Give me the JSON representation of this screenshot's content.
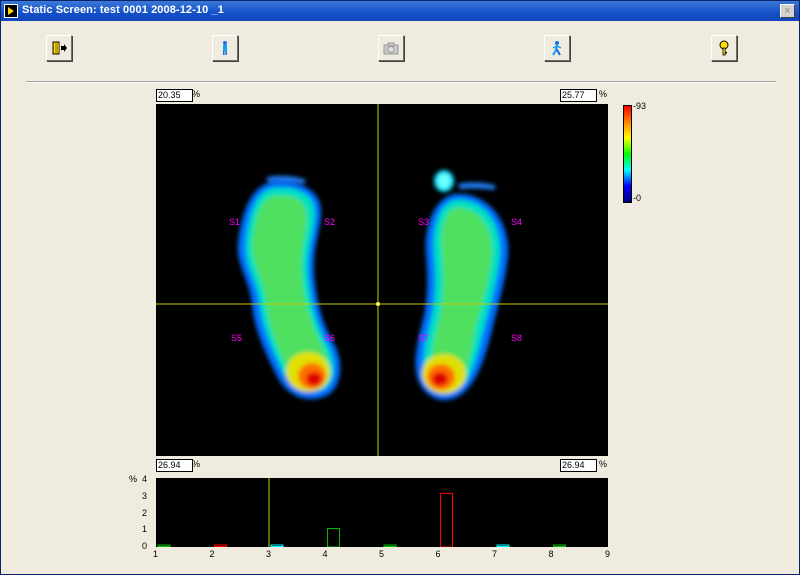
{
  "window": {
    "title": "Static Screen: test 0001 2008-12-10 _1",
    "close_label": "×"
  },
  "toolbar": [
    {
      "name": "exit-button",
      "icon": "exit-door-icon",
      "enabled": true
    },
    {
      "name": "standing-person-button",
      "icon": "standing-person-icon",
      "enabled": true
    },
    {
      "name": "camera-button",
      "icon": "camera-icon",
      "enabled": false
    },
    {
      "name": "walking-person-button",
      "icon": "walking-person-icon",
      "enabled": true
    },
    {
      "name": "help-button",
      "icon": "help-key-icon",
      "enabled": true
    }
  ],
  "quadrants": {
    "top_left": "20.35",
    "top_right": "25.77",
    "bottom_left": "26.94",
    "bottom_right": "26.94",
    "unit": "%"
  },
  "colorbar": {
    "max_label": "93",
    "min_label": "0"
  },
  "sensors": [
    "S1",
    "S2",
    "S3",
    "S4",
    "S5",
    "S6",
    "S7",
    "S8"
  ],
  "chart_data": {
    "type": "bar",
    "ylabel": "%",
    "ylim": [
      0,
      4
    ],
    "yticks": [
      "0",
      "1",
      "2",
      "3",
      "4"
    ],
    "xticks": [
      "1",
      "2",
      "3",
      "4",
      "5",
      "6",
      "7",
      "8",
      "9"
    ],
    "bars": [
      {
        "x": 1,
        "value": 0.0,
        "color": "#00c000"
      },
      {
        "x": 2,
        "value": 0.0,
        "color": "#ff0000"
      },
      {
        "x": 3,
        "value": 0.0,
        "color": "#00ffff"
      },
      {
        "x": 4,
        "value": 1.1,
        "color": "#00c000"
      },
      {
        "x": 5,
        "value": 0.0,
        "color": "#00c000"
      },
      {
        "x": 6,
        "value": 3.2,
        "color": "#ff0000"
      },
      {
        "x": 7,
        "value": 0.0,
        "color": "#00ffff"
      },
      {
        "x": 8,
        "value": 0.0,
        "color": "#00c000"
      }
    ],
    "cursor_x": 3,
    "cursor_color": "#c8c800"
  }
}
